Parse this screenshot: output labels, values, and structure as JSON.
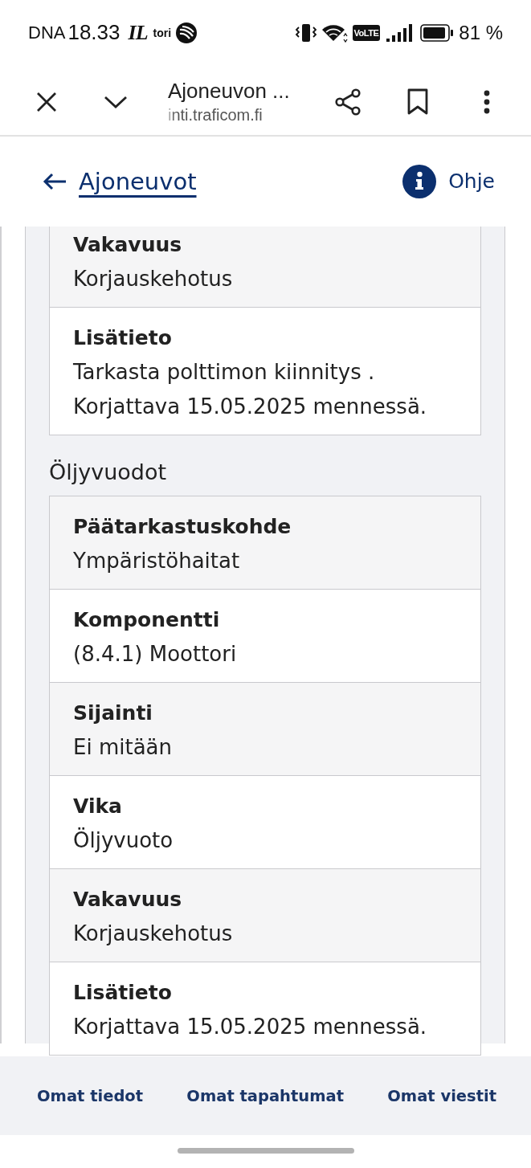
{
  "status_bar": {
    "carrier": "DNA",
    "time": "18.33",
    "notifications": [
      {
        "kind": "logo",
        "text": "IL"
      },
      {
        "kind": "label",
        "text": "tori"
      },
      {
        "kind": "round-logo"
      }
    ],
    "network_badge": "VoLTE",
    "battery": "81 %"
  },
  "browser_bar": {
    "title": "Ajoneuvon ...",
    "url": "inti.traficom.fi"
  },
  "page_header": {
    "back_link": "Ajoneuvot",
    "help_link": "Ohje"
  },
  "sections": [
    {
      "rows": [
        {
          "label": "Vakavuus",
          "value": "Korjauskehotus"
        },
        {
          "label": "Lisätieto",
          "value": "Tarkasta polttimon kiinnitys . Korjattava 15.05.2025 mennessä."
        }
      ]
    },
    {
      "heading": "Öljyvuodot",
      "rows": [
        {
          "label": "Päätarkastuskohde",
          "value": "Ympäristöhaitat"
        },
        {
          "label": "Komponentti",
          "value": "(8.4.1) Moottori"
        },
        {
          "label": "Sijainti",
          "value": "Ei mitään"
        },
        {
          "label": "Vika",
          "value": "Öljyvuoto"
        },
        {
          "label": "Vakavuus",
          "value": "Korjauskehotus"
        },
        {
          "label": "Lisätieto",
          "value": "Korjattava 15.05.2025 mennessä."
        }
      ]
    }
  ],
  "bottom_nav": [
    "Omat tiedot",
    "Omat tapahtumat",
    "Omat viestit"
  ]
}
